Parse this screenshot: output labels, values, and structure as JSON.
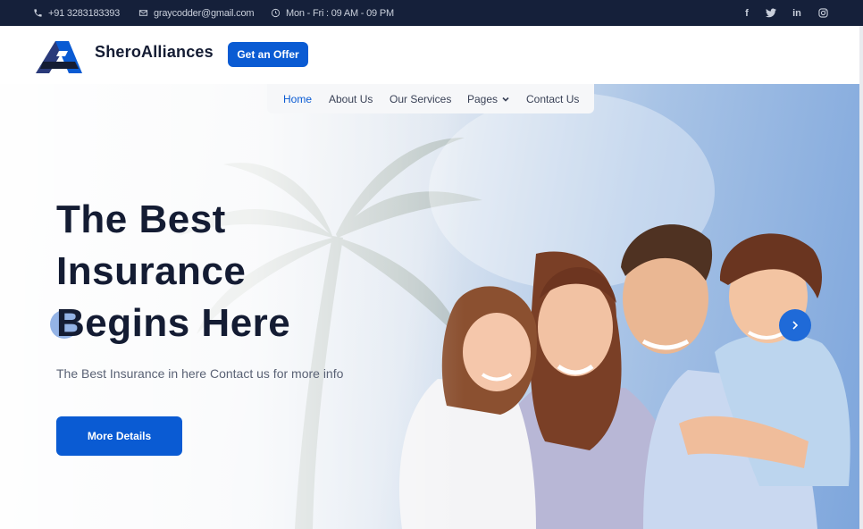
{
  "topbar": {
    "phone": "+91 3283183393",
    "email": "graycodder@gmail.com",
    "hours": "Mon - Fri : 09 AM - 09 PM",
    "social": [
      {
        "name": "facebook-icon",
        "glyph": "f"
      },
      {
        "name": "twitter-icon",
        "glyph": "t"
      },
      {
        "name": "linkedin-icon",
        "glyph": "in"
      },
      {
        "name": "instagram-icon",
        "glyph": ""
      }
    ]
  },
  "header": {
    "brand": "SheroAlliances",
    "offer_label": "Get an Offer"
  },
  "nav": {
    "items": [
      {
        "label": "Home",
        "active": true
      },
      {
        "label": "About Us"
      },
      {
        "label": "Our Services"
      },
      {
        "label": "Pages"
      },
      {
        "label": "Contact Us"
      }
    ]
  },
  "hero": {
    "headline_lines": [
      "The Best",
      "Insurance",
      "Begins Here"
    ],
    "subtext": "The Best Insurance in here Contact us for more info",
    "button_label": "More Details"
  },
  "colors": {
    "topbar_bg": "#15203a",
    "accent": "#0a5bd3",
    "heading": "#141c33"
  }
}
